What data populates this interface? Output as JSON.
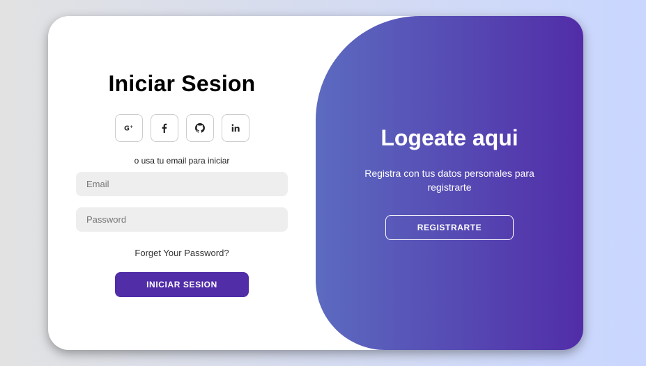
{
  "signin": {
    "title": "Iniciar Sesion",
    "socials": [
      {
        "icon": "google-plus-icon",
        "label": "G+"
      },
      {
        "icon": "facebook-icon",
        "label": "f"
      },
      {
        "icon": "github-icon",
        "label": ""
      },
      {
        "icon": "linkedin-icon",
        "label": "in"
      }
    ],
    "hint": "o usa tu email para iniciar",
    "email_placeholder": "Email",
    "password_placeholder": "Password",
    "forgot": "Forget Your Password?",
    "submit": "INICIAR SESION"
  },
  "toggle": {
    "title": "Logeate aqui",
    "text": "Registra con tus datos personales para registrarte",
    "button": "REGISTRARTE"
  },
  "colors": {
    "accent": "#512da8",
    "gradient_start": "#5c6bc0",
    "input_bg": "#eeeeee"
  }
}
